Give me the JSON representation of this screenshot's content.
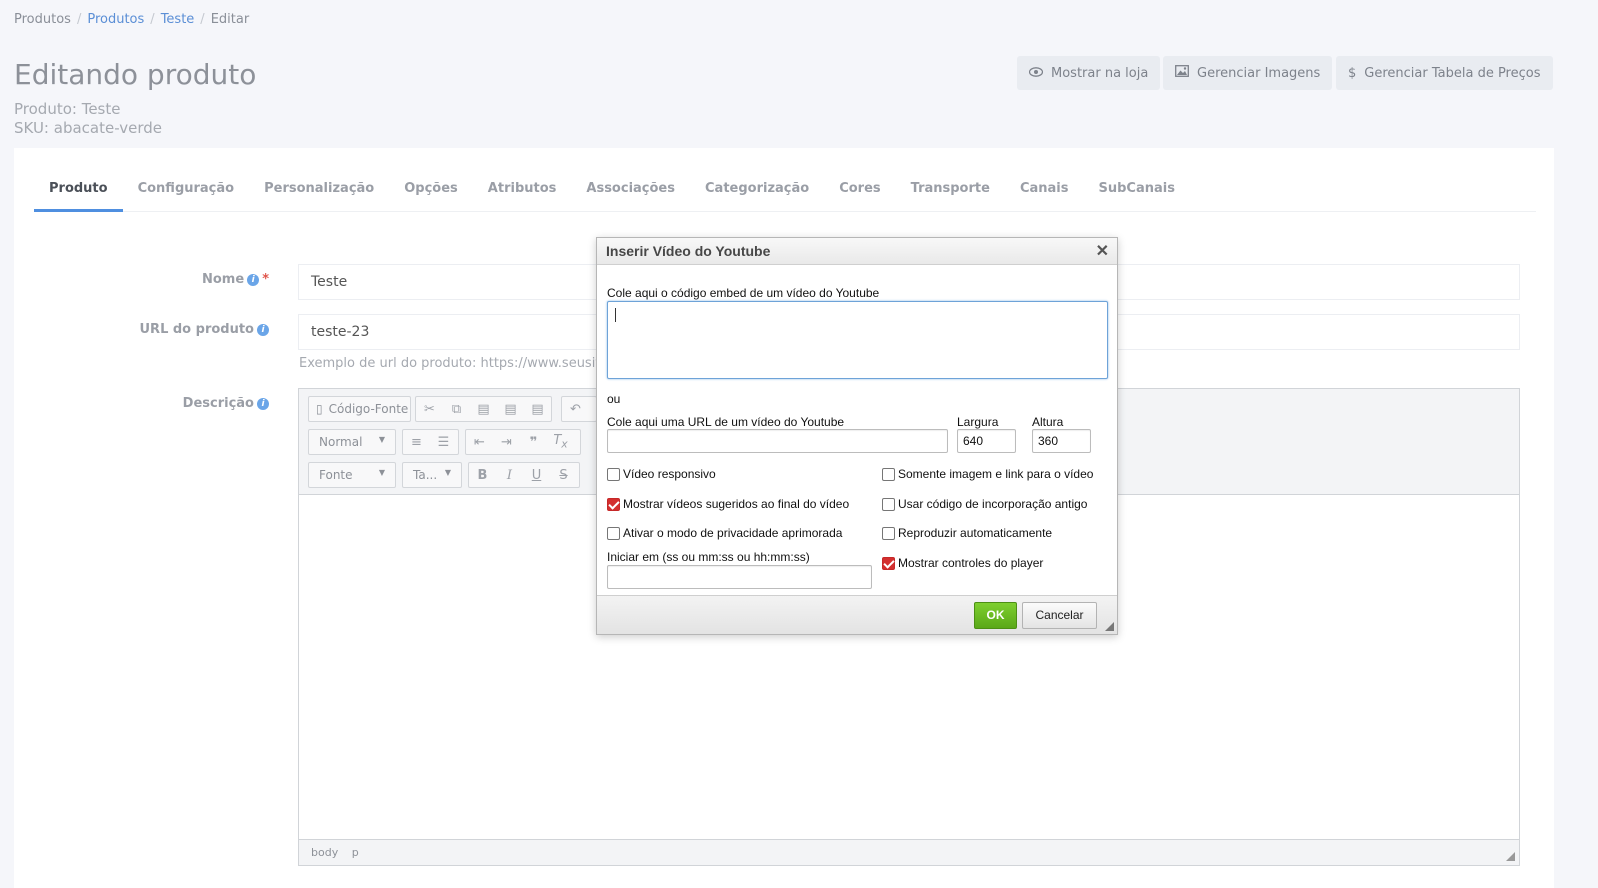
{
  "breadcrumb": [
    "Produtos",
    "Produtos",
    "Teste",
    "Editar"
  ],
  "page": {
    "title": "Editando produto",
    "product_line": "Produto: Teste",
    "sku_line": "SKU: abacate-verde"
  },
  "header_buttons": {
    "show_store": "Mostrar na loja",
    "manage_images": "Gerenciar Imagens",
    "manage_prices": "Gerenciar Tabela de Preços"
  },
  "tabs": [
    "Produto",
    "Configuração",
    "Personalização",
    "Opções",
    "Atributos",
    "Associações",
    "Categorização",
    "Cores",
    "Transporte",
    "Canais",
    "SubCanais"
  ],
  "form": {
    "name_label": "Nome",
    "name_value": "Teste",
    "url_label": "URL do produto",
    "url_value": "teste-23",
    "url_hint": "Exemplo de url do produto: https://www.seusite",
    "description_label": "Descrição"
  },
  "editor": {
    "source_label": "Código-Fonte",
    "format_combo": "Normal",
    "font_combo": "Fonte",
    "size_combo": "Ta...",
    "footer_path": [
      "body",
      "p"
    ]
  },
  "dialog": {
    "title": "Inserir Vídeo do Youtube",
    "embed_label": "Cole aqui o código embed de um vídeo do Youtube",
    "or_label": "ou",
    "url_label": "Cole aqui uma URL de um vídeo do Youtube",
    "width_label": "Largura",
    "width_value": "640",
    "height_label": "Altura",
    "height_value": "360",
    "responsive_label": "Vídeo responsivo",
    "image_only_label": "Somente imagem e link para o vídeo",
    "suggested_label": "Mostrar vídeos sugeridos ao final do vídeo",
    "old_embed_label": "Usar código de incorporação antigo",
    "privacy_label": "Ativar o modo de privacidade aprimorada",
    "autoplay_label": "Reproduzir automaticamente",
    "start_label": "Iniciar em (ss ou mm:ss ou hh:mm:ss)",
    "controls_label": "Mostrar controles do player",
    "ok_label": "OK",
    "cancel_label": "Cancelar"
  }
}
